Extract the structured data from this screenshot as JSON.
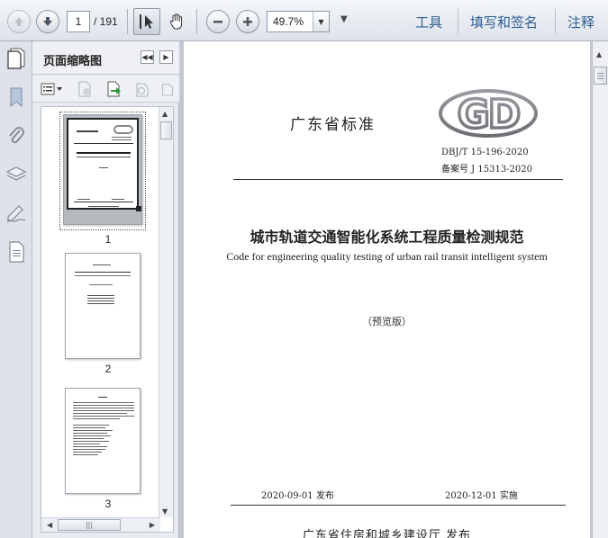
{
  "toolbar": {
    "current_page": "1",
    "total_pages": "/ 191",
    "zoom": "49.7%",
    "menu": {
      "tools": "工具",
      "fill_sign": "填写和签名",
      "comment": "注释"
    }
  },
  "panel": {
    "title": "页面缩略图",
    "thumbnails": [
      {
        "label": "1"
      },
      {
        "label": "2"
      },
      {
        "label": "3"
      }
    ]
  },
  "document": {
    "standard_label": "广东省标准",
    "logo_text": "GD",
    "std_number": "DBJ/T 15-196-2020",
    "record_number": "备案号  J 15313-2020",
    "title_cn": "城市轨道交通智能化系统工程质量检测规范",
    "title_en": "Code for engineering quality testing of urban rail transit intelligent system",
    "draft_label": "（预览版）",
    "issue_date": "2020-09-01  发布",
    "impl_date": "2020-12-01  实施",
    "issuer": "广东省住房和城乡建设厅   发布"
  },
  "colors": {
    "accent": "#2c5d92",
    "logo": "#7e7e84"
  },
  "icons": [
    "arrow-up-icon",
    "arrow-down-icon",
    "select-arrow-icon",
    "hand-icon",
    "zoom-out-icon",
    "zoom-in-icon",
    "pages-icon",
    "bookmark-icon",
    "attachment-icon",
    "layers-icon",
    "signature-icon",
    "document-icon"
  ]
}
